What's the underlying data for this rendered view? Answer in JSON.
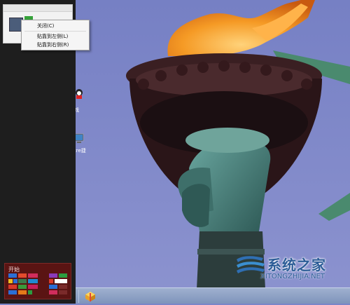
{
  "context_menu": {
    "items": [
      {
        "label": "关闭(C)"
      },
      {
        "label": "贴靠到左侧(L)"
      },
      {
        "label": "贴靠到右侧(R)"
      }
    ]
  },
  "start_tile": {
    "label": "开始"
  },
  "desktop_icons": [
    {
      "name": "qq-game-icon",
      "label": "戏"
    },
    {
      "name": "computer-icon",
      "label": "tre捷"
    }
  ],
  "watermark": {
    "brand": "系统之家",
    "url": "XITONGZHIJIA.NET"
  },
  "colors": {
    "sky": "#7b86c8",
    "flame": "#f08a1a",
    "torch": "#3f2424",
    "arm": "#4f8c86",
    "panel": "#1e1e1e",
    "start_tile": "#5a1413"
  }
}
